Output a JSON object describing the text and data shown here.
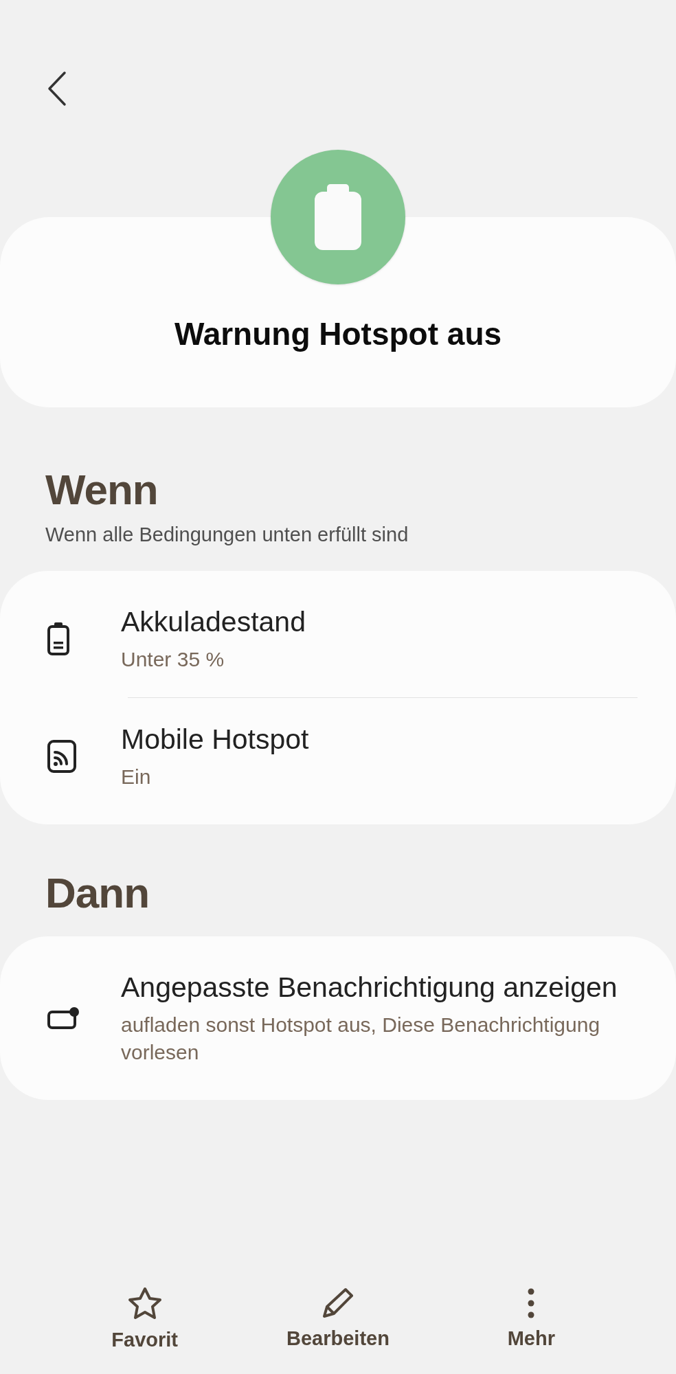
{
  "header": {
    "title": "Warnung Hotspot aus"
  },
  "conditions": {
    "heading": "Wenn",
    "subtitle": "Wenn alle Bedingungen unten erfüllt sind",
    "items": [
      {
        "kind": "battery",
        "title": "Akkuladestand",
        "value": "Unter 35 %"
      },
      {
        "kind": "hotspot",
        "title": "Mobile Hotspot",
        "value": "Ein"
      }
    ]
  },
  "actions": {
    "heading": "Dann",
    "items": [
      {
        "kind": "notification",
        "title": "Angepasste Benachrichtigung anzeigen",
        "value": "aufladen sonst Hotspot aus, Diese Benachrichtigung vorlesen"
      }
    ]
  },
  "bottom_bar": [
    {
      "kind": "star",
      "label": "Favorit"
    },
    {
      "kind": "pencil",
      "label": "Bearbeiten"
    },
    {
      "kind": "more",
      "label": "Mehr"
    }
  ]
}
